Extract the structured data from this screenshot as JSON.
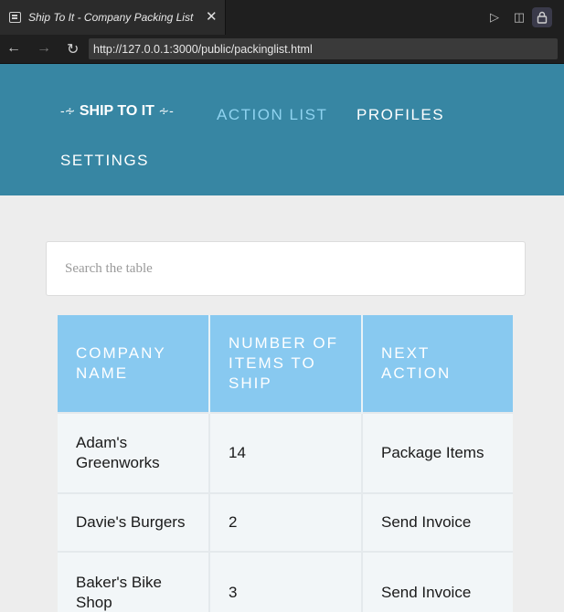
{
  "browser": {
    "tab_title": "Ship To It - Company Packing List",
    "url": "http://127.0.0.1:3000/public/packinglist.html"
  },
  "header": {
    "brand": "SHIP TO IT",
    "nav": {
      "action_list": "ACTION LIST",
      "profiles": "PROFILES",
      "settings": "SETTINGS"
    },
    "active_color": "#8fd3f0",
    "bg_color": "#3786a3"
  },
  "search": {
    "placeholder": "Search the table",
    "value": ""
  },
  "table": {
    "columns": [
      "COMPANY NAME",
      "NUMBER OF ITEMS TO SHIP",
      "NEXT ACTION"
    ],
    "rows": [
      [
        "Adam's Greenworks",
        "14",
        "Package Items"
      ],
      [
        "Davie's Burgers",
        "2",
        "Send Invoice"
      ],
      [
        "Baker's Bike Shop",
        "3",
        "Send Invoice"
      ]
    ],
    "header_color": "#88c9f0"
  }
}
